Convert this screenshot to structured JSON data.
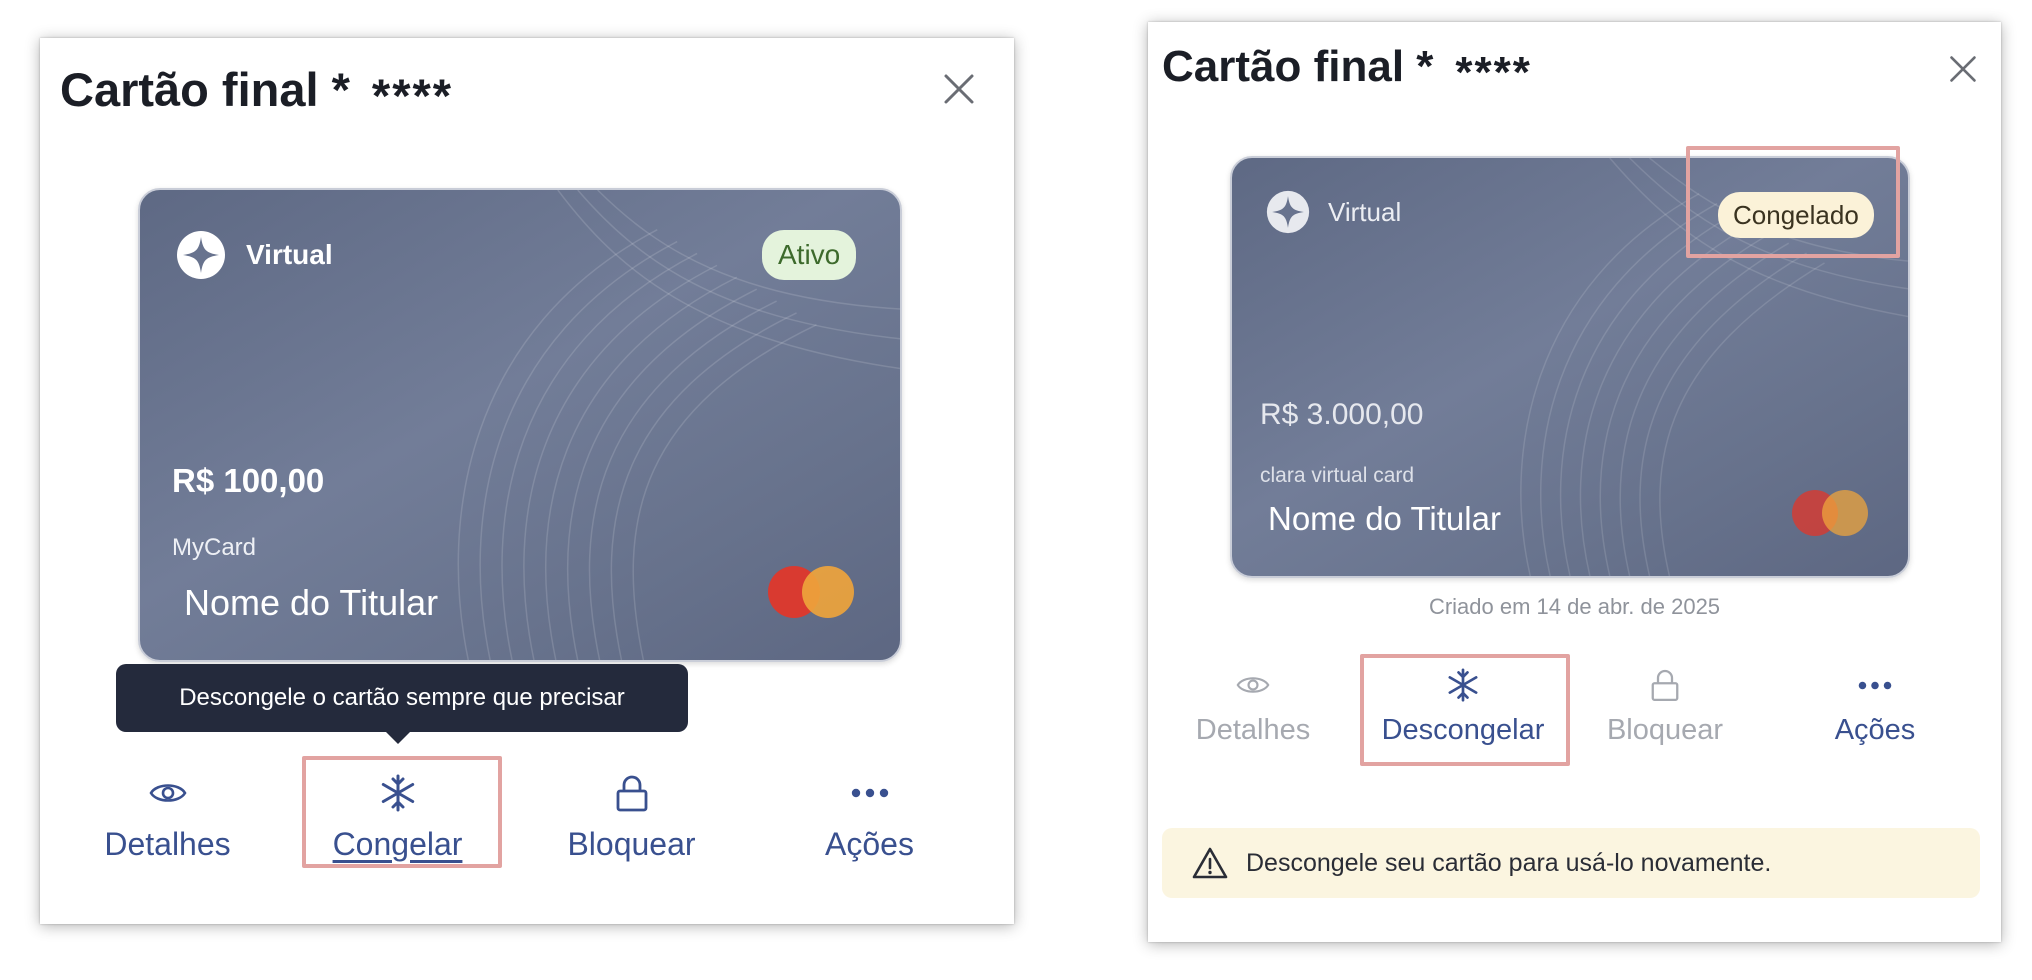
{
  "left_panel": {
    "title": "Cartão final *",
    "masked_number": "****",
    "close_icon": "close-icon",
    "card": {
      "type_label": "Virtual",
      "status": "Ativo",
      "amount": "R$ 100,00",
      "card_name": "MyCard",
      "holder_name": "Nome do Titular",
      "network_icon": "mastercard-logo"
    },
    "tooltip": "Descongele o cartão sempre que precisar",
    "actions": [
      {
        "label": "Detalhes",
        "icon": "eye-icon"
      },
      {
        "label": "Congelar",
        "icon": "snowflake-icon"
      },
      {
        "label": "Bloquear",
        "icon": "lock-icon"
      },
      {
        "label": "Ações",
        "icon": "more-dots-icon"
      }
    ]
  },
  "right_panel": {
    "title": "Cartão final *",
    "masked_number": "****",
    "close_icon": "close-icon",
    "card": {
      "type_label": "Virtual",
      "status": "Congelado",
      "amount": "R$ 3.000,00",
      "card_name": "clara virtual card",
      "holder_name": "Nome do Titular",
      "network_icon": "mastercard-logo"
    },
    "created_text": "Criado em 14 de abr. de 2025",
    "actions": [
      {
        "label": "Detalhes",
        "icon": "eye-icon"
      },
      {
        "label": "Descongelar",
        "icon": "snowflake-icon"
      },
      {
        "label": "Bloquear",
        "icon": "lock-icon"
      },
      {
        "label": "Ações",
        "icon": "more-dots-icon"
      }
    ],
    "notice": {
      "text": "Descongele seu cartão para usá-lo novamente.",
      "icon": "warning-icon"
    }
  },
  "colors": {
    "action_blue": "#39508f",
    "action_disabled": "#a6a9b0",
    "highlight": "#e2a3a1",
    "badge_active_bg": "#e4f3dc",
    "badge_active_text": "#3d6a2c",
    "badge_frozen_bg": "#fbf2d8",
    "badge_frozen_text": "#3a3320",
    "tooltip_bg": "#242a3c",
    "notice_bg": "#fbf5e0"
  }
}
